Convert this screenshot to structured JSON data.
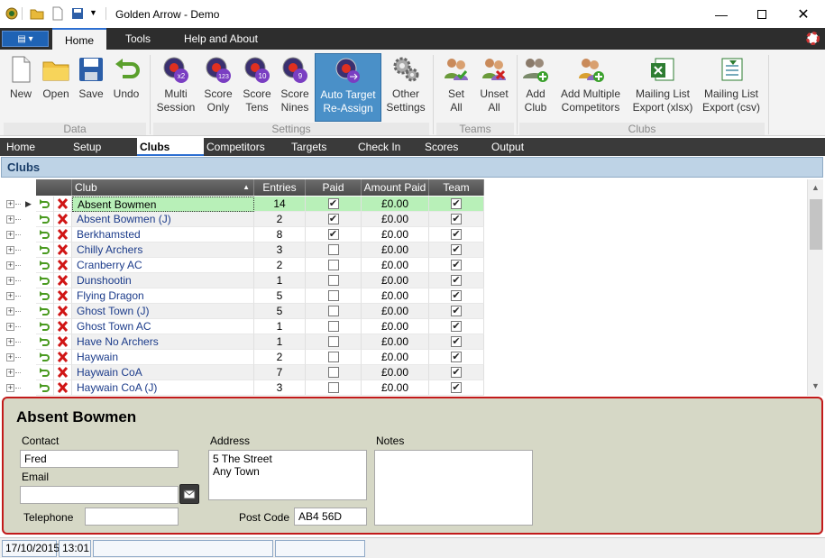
{
  "window": {
    "title": "Golden Arrow - Demo"
  },
  "ribbon": {
    "tabs": [
      "Home",
      "Tools",
      "Help and About"
    ],
    "buttons": {
      "new": "New",
      "open": "Open",
      "save": "Save",
      "undo": "Undo",
      "multi_session_1": "Multi",
      "multi_session_2": "Session",
      "score_only_1": "Score",
      "score_only_2": "Only",
      "score_tens_1": "Score",
      "score_tens_2": "Tens",
      "score_nines_1": "Score",
      "score_nines_2": "Nines",
      "auto_target_1": "Auto Target",
      "auto_target_2": "Re-Assign",
      "other_settings_1": "Other",
      "other_settings_2": "Settings",
      "set_all_1": "Set",
      "set_all_2": "All",
      "unset_all_1": "Unset",
      "unset_all_2": "All",
      "add_club_1": "Add",
      "add_club_2": "Club",
      "add_multi_1": "Add Multiple",
      "add_multi_2": "Competitors",
      "mail_xlsx_1": "Mailing List",
      "mail_xlsx_2": "Export (xlsx)",
      "mail_csv_1": "Mailing List",
      "mail_csv_2": "Export (csv)"
    },
    "groups": {
      "data": "Data",
      "settings": "Settings",
      "teams": "Teams",
      "clubs": "Clubs"
    },
    "icon_numbers": {
      "multi": "x2",
      "only": "123",
      "tens": "10",
      "nines": "9"
    }
  },
  "nav": [
    "Home",
    "Setup",
    "Clubs",
    "Competitors",
    "Targets",
    "Check In",
    "Scores",
    "Output"
  ],
  "section": {
    "title": "Clubs"
  },
  "grid": {
    "headers": {
      "club": "Club",
      "entries": "Entries",
      "paid": "Paid",
      "amount": "Amount Paid",
      "team": "Team"
    },
    "rows": [
      {
        "club": "Absent Bowmen",
        "entries": "14",
        "paid": true,
        "amount": "£0.00",
        "team": true
      },
      {
        "club": "Absent Bowmen (J)",
        "entries": "2",
        "paid": true,
        "amount": "£0.00",
        "team": true
      },
      {
        "club": "Berkhamsted",
        "entries": "8",
        "paid": true,
        "amount": "£0.00",
        "team": true
      },
      {
        "club": "Chilly Archers",
        "entries": "3",
        "paid": false,
        "amount": "£0.00",
        "team": true
      },
      {
        "club": "Cranberry AC",
        "entries": "2",
        "paid": false,
        "amount": "£0.00",
        "team": true
      },
      {
        "club": "Dunshootin",
        "entries": "1",
        "paid": false,
        "amount": "£0.00",
        "team": true
      },
      {
        "club": "Flying Dragon",
        "entries": "5",
        "paid": false,
        "amount": "£0.00",
        "team": true
      },
      {
        "club": "Ghost Town (J)",
        "entries": "5",
        "paid": false,
        "amount": "£0.00",
        "team": true
      },
      {
        "club": "Ghost Town AC",
        "entries": "1",
        "paid": false,
        "amount": "£0.00",
        "team": true
      },
      {
        "club": "Have No Archers",
        "entries": "1",
        "paid": false,
        "amount": "£0.00",
        "team": true
      },
      {
        "club": "Haywain",
        "entries": "2",
        "paid": false,
        "amount": "£0.00",
        "team": true
      },
      {
        "club": "Haywain CoA",
        "entries": "7",
        "paid": false,
        "amount": "£0.00",
        "team": true
      },
      {
        "club": "Haywain CoA (J)",
        "entries": "3",
        "paid": false,
        "amount": "£0.00",
        "team": true
      }
    ]
  },
  "detail": {
    "name": "Absent Bowmen",
    "contact_label": "Contact",
    "contact": "Fred",
    "email_label": "Email",
    "email": "",
    "telephone_label": "Telephone",
    "telephone": "",
    "address_label": "Address",
    "address": "5 The Street\nAny Town",
    "postcode_label": "Post Code",
    "postcode": "AB4 56D",
    "notes_label": "Notes",
    "notes": ""
  },
  "status": {
    "date": "17/10/2015",
    "time": "13:01"
  },
  "colors": {
    "selected_row": "#b8f0b8",
    "alt_row": "#f0f0f0",
    "link_text": "#1b3b8a",
    "detail_border": "#c21a1a",
    "detail_bg": "#d6d8c6"
  }
}
